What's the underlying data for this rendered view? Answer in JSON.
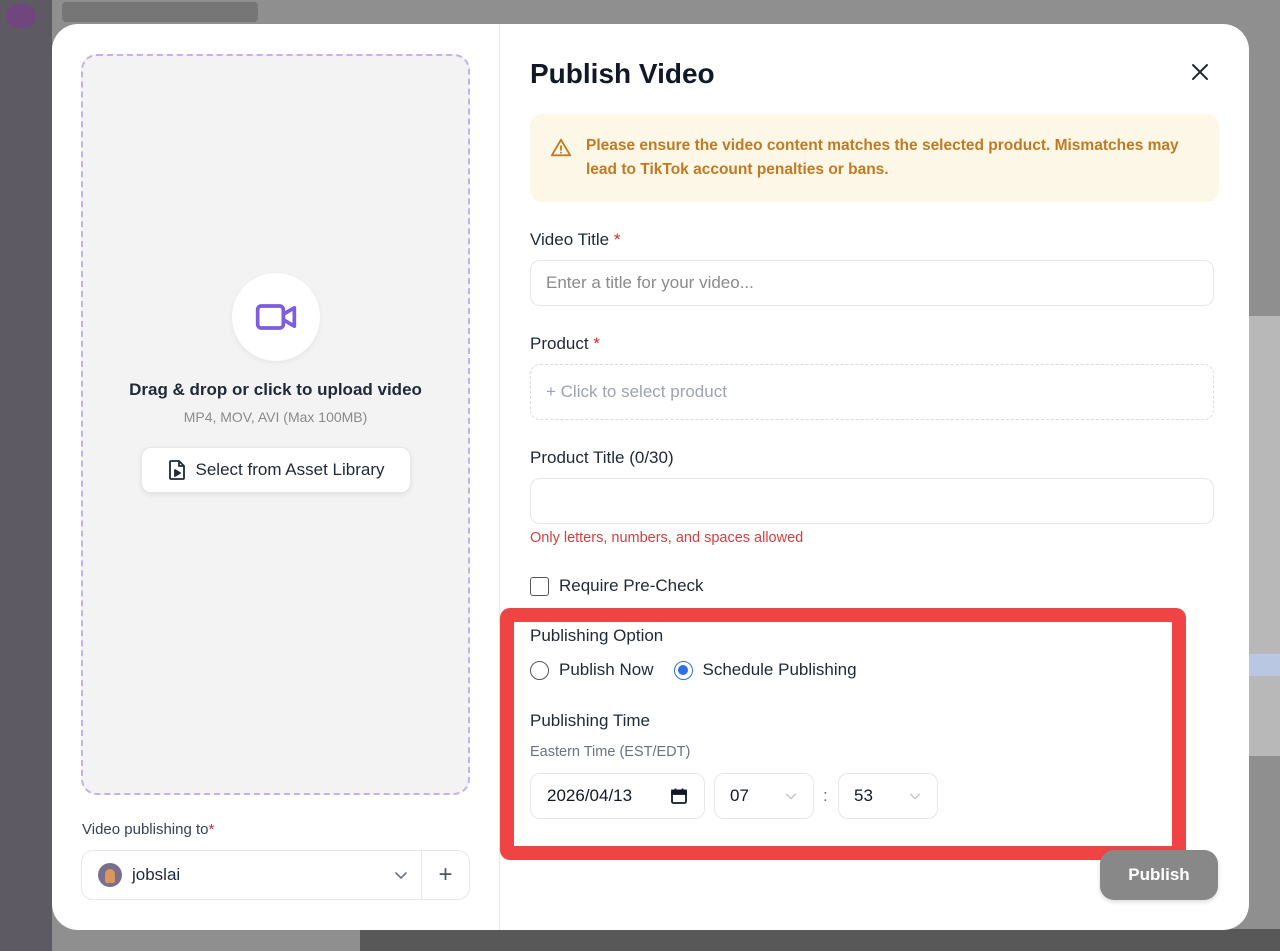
{
  "modal": {
    "title": "Publish Video",
    "warning": "Please ensure the video content matches the selected product. Mismatches may lead to TikTok account penalties or bans."
  },
  "upload": {
    "title": "Drag & drop or click to upload video",
    "hint": "MP4, MOV, AVI (Max 100MB)",
    "asset_button": "Select from Asset Library"
  },
  "publishing_to": {
    "label": "Video publishing to",
    "required_mark": "*",
    "account": "jobslai",
    "add_symbol": "+"
  },
  "form": {
    "video_title": {
      "label": "Video Title",
      "required_mark": "*",
      "value": "",
      "placeholder": "Enter a title for your video..."
    },
    "product": {
      "label": "Product",
      "required_mark": "*",
      "picker": "+ Click to select product"
    },
    "product_title": {
      "label": "Product Title (0/30)",
      "value": "",
      "error": "Only letters, numbers, and spaces allowed"
    },
    "pre_check": {
      "label": "Require Pre-Check",
      "checked": false
    }
  },
  "publishing": {
    "option_label": "Publishing Option",
    "options": [
      {
        "label": "Publish Now",
        "checked": false
      },
      {
        "label": "Schedule Publishing",
        "checked": true
      }
    ],
    "time_label": "Publishing Time",
    "timezone": "Eastern Time (EST/EDT)",
    "date": "2026/04/13",
    "hour": "07",
    "separator": ":",
    "minute": "53"
  },
  "actions": {
    "publish": "Publish"
  },
  "colors": {
    "accent": "#7c5ce0",
    "radio_selected": "#2f6fe0",
    "highlight": "#f04444",
    "warning_text": "#c27a22",
    "warning_bg": "#fdf7e7",
    "error": "#d63e3e",
    "publish_button": "#888888"
  },
  "icons": {
    "upload": "video-camera-icon",
    "asset": "file-video-icon",
    "warning": "warning-triangle-icon",
    "close": "close-icon",
    "calendar": "calendar-icon",
    "chevron": "chevron-down-icon"
  }
}
